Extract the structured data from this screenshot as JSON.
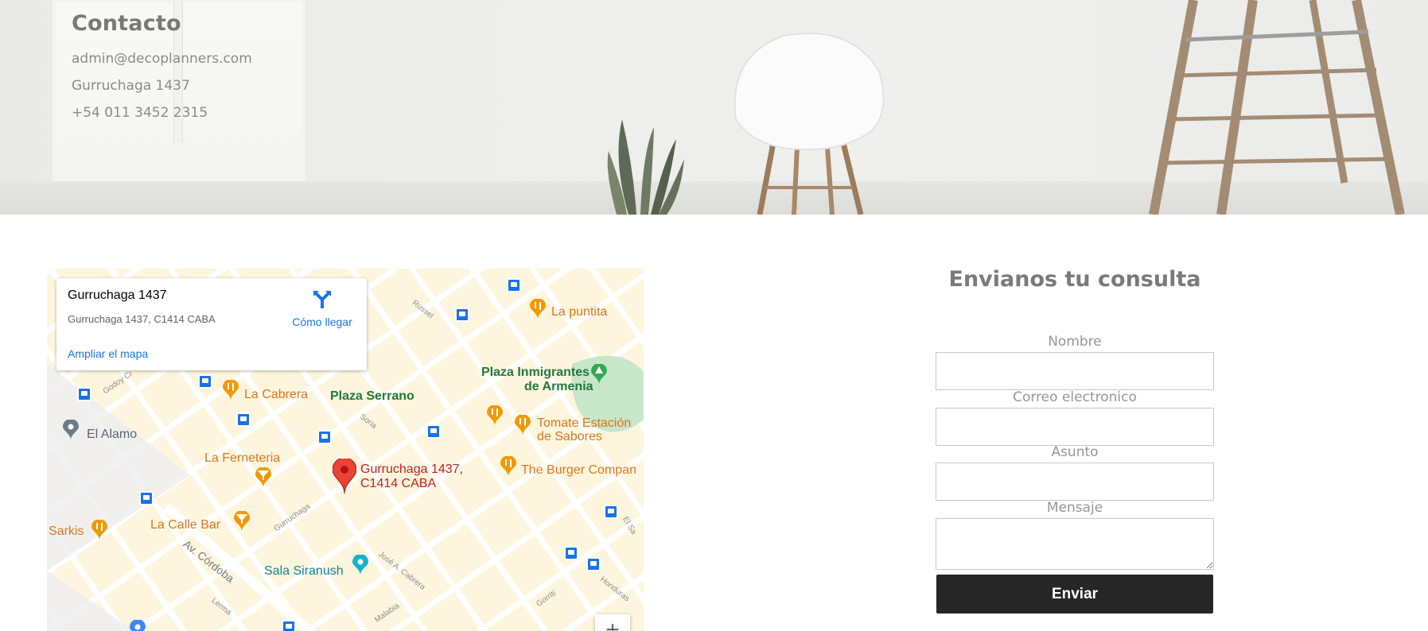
{
  "contact": {
    "title": "Contacto",
    "email": "admin@decoplanners.com",
    "address": "Gurruchaga 1437",
    "phone": "+54 011 3452 2315"
  },
  "map": {
    "card": {
      "title": "Gurruchaga 1437",
      "address": "Gurruchaga 1437, C1414 CABA",
      "directions_label": "Cómo llegar",
      "enlarge_label": "Ampliar el mapa"
    },
    "marker_label_line1": "Gurruchaga 1437,",
    "marker_label_line2": "C1414 CABA",
    "zoom_in_label": "+",
    "places": {
      "la_puntita": "La puntita",
      "la_cabrera": "La Cabrera",
      "plaza_serrano": "Plaza Serrano",
      "plaza_inmigrantes_1": "Plaza Inmigrantes",
      "plaza_inmigrantes_2": "de Armenia",
      "el_alamo": "El Alamo",
      "tomate_1": "Tomate Estación",
      "tomate_2": "de Sabores",
      "la_ferneteria": "La Ferneteria",
      "burger": "The Burger Compan",
      "sarkis": "Sarkis",
      "la_calle_bar": "La Calle Bar",
      "sala_siranush": "Sala Siranush"
    },
    "streets": {
      "av_cordoba": "Av. Córdoba",
      "gurruchaga": "Gurruchaga",
      "soria": "Soria",
      "jose_cabrera": "José A. Cabrera",
      "malabia": "Malabia",
      "honduras": "Honduras",
      "gorriti": "Gorriti",
      "russel": "Russel",
      "lerma": "Lerma",
      "godoy_cruz": "Godoy Cr",
      "el_salvador": "El Sa"
    },
    "colors": {
      "food": "#f29900",
      "bus": "#1a73e8",
      "park": "#c8e6c9",
      "marker": "#ea4335"
    }
  },
  "form": {
    "title": "Envianos tu consulta",
    "name_label": "Nombre",
    "email_label": "Correo electronico",
    "subject_label": "Asunto",
    "message_label": "Mensaje",
    "submit_label": "Enviar"
  }
}
